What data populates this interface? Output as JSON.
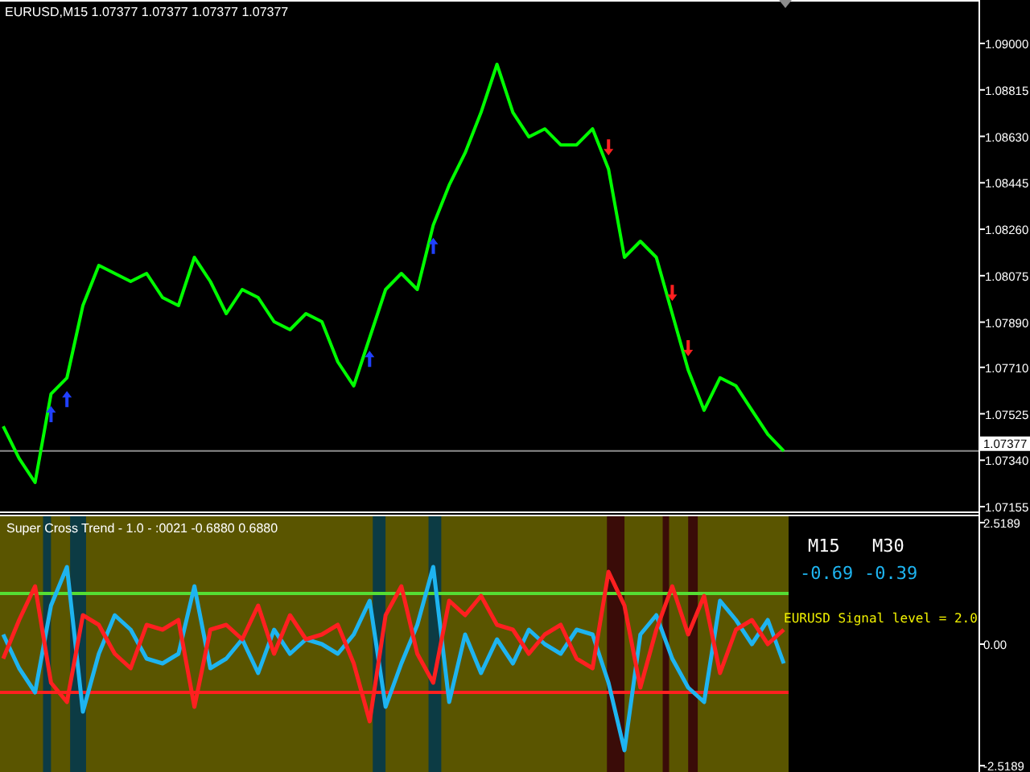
{
  "price_chart": {
    "title": "EURUSD,M15  1.07377 1.07377 1.07377 1.07377",
    "chart_data": {
      "type": "line",
      "ylim": [
        1.07136,
        1.09173
      ],
      "categories": [
        null,
        null,
        null,
        null,
        null,
        null,
        null,
        null,
        null,
        null,
        null,
        null,
        null,
        null,
        null,
        null,
        null,
        null,
        null,
        null,
        null,
        null,
        null,
        null,
        null,
        null,
        null,
        null,
        null,
        null,
        null,
        null,
        null,
        null,
        null,
        null,
        null,
        null,
        null,
        null,
        null,
        null,
        null,
        null,
        null,
        null,
        null,
        null,
        null,
        null
      ],
      "yticks": [
        {
          "value": 1.09,
          "label": "1.09000"
        },
        {
          "value": 1.08815,
          "label": "1.08815"
        },
        {
          "value": 1.0863,
          "label": "1.08630"
        },
        {
          "value": 1.08445,
          "label": "1.08445"
        },
        {
          "value": 1.0826,
          "label": "1.08260"
        },
        {
          "value": 1.08075,
          "label": "1.08075"
        },
        {
          "value": 1.0789,
          "label": "1.07890"
        },
        {
          "value": 1.0771,
          "label": "1.07710"
        },
        {
          "value": 1.07525,
          "label": "1.07525"
        },
        {
          "value": 1.0734,
          "label": "1.07340"
        },
        {
          "value": 1.07155,
          "label": "1.07155"
        }
      ],
      "series": [
        {
          "color": "#00ff00",
          "values": [
            1.07475,
            1.07347,
            1.07251,
            1.07604,
            1.07668,
            1.07956,
            1.08116,
            1.08084,
            1.08052,
            1.08084,
            1.07988,
            1.07956,
            1.08148,
            1.08052,
            1.07924,
            1.0802,
            1.07988,
            1.07892,
            1.0786,
            1.07924,
            1.07892,
            1.07732,
            1.07636,
            1.07828,
            1.0802,
            1.08084,
            1.0802,
            1.08276,
            1.08436,
            1.08564,
            1.08725,
            1.08917,
            1.08725,
            1.08628,
            1.0866,
            1.08596,
            1.08596,
            1.0866,
            1.085,
            1.08148,
            1.08212,
            1.08148,
            1.07924,
            1.077,
            1.07539,
            1.07668,
            1.07636,
            1.07539,
            1.07443,
            1.07377
          ]
        }
      ],
      "ref_lines": [
        {
          "axis": "y",
          "value": 1.07377,
          "label": "1.07377"
        }
      ]
    }
  },
  "indicator": {
    "title": "Super Cross Trend - 1.0 - :0021 -0.6880 0.6880",
    "chart_data": {
      "type": "line",
      "ylim": [
        -2.65,
        2.65
      ],
      "categories": [
        null,
        null,
        null,
        null,
        null,
        null,
        null,
        null,
        null,
        null,
        null,
        null,
        null,
        null,
        null,
        null,
        null,
        null,
        null,
        null,
        null,
        null,
        null,
        null,
        null,
        null,
        null,
        null,
        null,
        null,
        null,
        null,
        null,
        null,
        null,
        null,
        null,
        null,
        null,
        null,
        null,
        null,
        null,
        null,
        null,
        null,
        null,
        null,
        null,
        null
      ],
      "yticks": [
        {
          "value": 2.5189,
          "label": "2.5189"
        },
        {
          "value": 0,
          "label": "0.00"
        },
        {
          "value": -2.5189,
          "label": "-2.5189"
        }
      ],
      "series": [
        {
          "color": "#1eb4f0",
          "values": [
            0.2,
            -0.5,
            -1.0,
            0.8,
            1.6,
            -1.4,
            -0.2,
            0.6,
            0.3,
            -0.3,
            -0.4,
            -0.2,
            1.2,
            -0.5,
            -0.3,
            0.1,
            -0.6,
            0.3,
            -0.2,
            0.1,
            0.0,
            -0.2,
            0.2,
            0.9,
            -1.3,
            -0.4,
            0.4,
            1.6,
            -1.2,
            0.2,
            -0.6,
            0.1,
            -0.4,
            0.3,
            0.0,
            -0.2,
            0.3,
            0.2,
            -0.8,
            -2.2,
            0.2,
            0.6,
            -0.3,
            -0.9,
            -1.2,
            0.9,
            0.5,
            0.0,
            0.5,
            -0.4
          ]
        },
        {
          "color": "#ff2020",
          "values": [
            -0.3,
            0.5,
            1.2,
            -0.8,
            -1.2,
            0.6,
            0.4,
            -0.2,
            -0.5,
            0.4,
            0.3,
            0.5,
            -1.3,
            0.3,
            0.4,
            0.1,
            0.8,
            -0.2,
            0.6,
            0.1,
            0.2,
            0.4,
            -0.4,
            -1.6,
            0.6,
            1.2,
            -0.2,
            -0.8,
            0.9,
            0.6,
            1.0,
            0.4,
            0.3,
            -0.2,
            0.2,
            0.4,
            -0.3,
            -0.5,
            1.5,
            0.8,
            -0.9,
            0.3,
            1.2,
            0.2,
            1.0,
            -0.6,
            0.3,
            0.5,
            0.0,
            0.3
          ]
        }
      ],
      "ref_lines": [
        {
          "axis": "y",
          "value": 1.05,
          "color": "#55dd33"
        },
        {
          "axis": "y",
          "value": -1.0,
          "color": "#ff2020"
        }
      ]
    }
  },
  "signals": {
    "timeframes": [
      {
        "label": "M15",
        "value": "-0.69"
      },
      {
        "label": "M30",
        "value": "-0.39"
      }
    ],
    "message": "EURUSD Signal level = 2.0"
  }
}
